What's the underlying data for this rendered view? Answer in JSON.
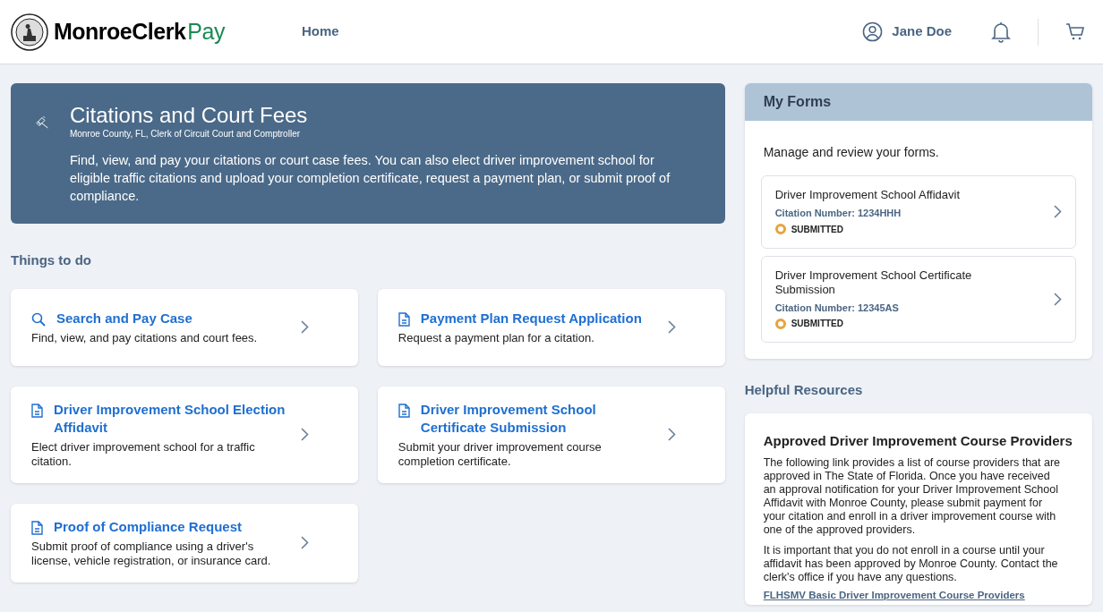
{
  "header": {
    "brand": {
      "part_1": "MonroeClerk",
      "part_2": "Pay"
    },
    "nav": [
      {
        "label": "Home",
        "selected": false
      }
    ],
    "user": "Jane Doe"
  },
  "banner": {
    "title": "Citations and Court Fees",
    "subtitle": "Monroe County, FL, Clerk of Circuit Court and Comptroller",
    "description": "Find, view, and pay your citations or court case fees. You can also elect driver improvement school for eligible traffic citations and upload your completion certificate, request a payment plan, or submit proof of compliance."
  },
  "things_to_do": {
    "heading": "Things to do",
    "tasks": [
      {
        "kind": "search",
        "title": "Search and Pay Case",
        "description": "Find, view, and pay citations and court fees."
      },
      {
        "kind": "form",
        "title": "Payment Plan Request Application",
        "description": "Request a payment plan for a citation."
      },
      {
        "kind": "form",
        "title": "Driver Improvement School Election Affidavit",
        "description": "Elect driver improvement school for a traffic citation."
      },
      {
        "kind": "form",
        "title": "Driver Improvement School Certificate Submission",
        "description": "Submit your driver improvement course completion certificate."
      },
      {
        "kind": "form",
        "title": "Proof of Compliance Request",
        "description": "Submit proof of compliance using a driver's license, vehicle registration, or insurance card."
      }
    ]
  },
  "my_forms": {
    "title": "My Forms",
    "intro": "Manage and review your forms.",
    "forms": [
      {
        "title": "Driver Improvement School Affidavit",
        "citation": "Citation Number: 1234HHH",
        "status": "SUBMITTED",
        "color": "#e8a33d"
      },
      {
        "title": "Driver Improvement School Certificate Submission",
        "citation": "Citation Number: 12345AS",
        "status": "SUBMITTED",
        "color": "#e8a33d"
      }
    ]
  },
  "helpful_resources": {
    "heading": "Helpful Resources",
    "card": {
      "title": "Approved Driver Improvement Course Providers",
      "paragraphs": [
        "The following link provides a list of course providers that are approved in The State of Florida. Once you have received an approval notification for your Driver Improvement School Affidavit with Monroe County, please submit payment for your citation and enroll in a driver improvement course with one of the approved providers.",
        "It is important that you do not enroll in a course until your affidavit has been approved by Monroe County. Contact the clerk's office if you have any questions."
      ],
      "link": "FLHSMV Basic Driver Improvement Course Providers"
    }
  }
}
